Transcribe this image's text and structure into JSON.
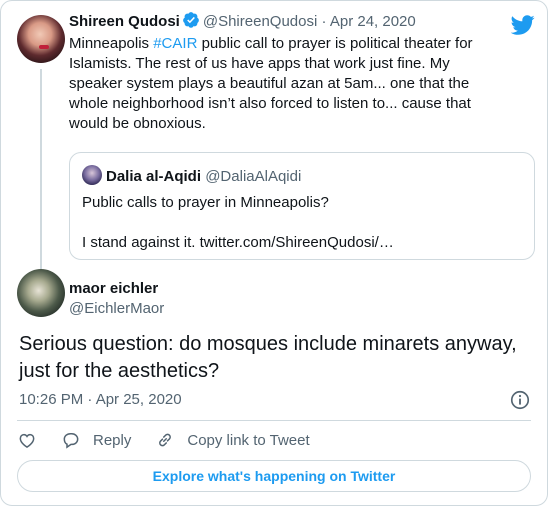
{
  "colors": {
    "accent": "#1d9bf0",
    "text": "#0f1419",
    "muted": "#536471",
    "border": "#cfd9de"
  },
  "icons": {
    "brand": "twitter-bird-icon",
    "verified": "verified-badge-icon",
    "info": "info-icon",
    "like": "heart-icon",
    "reply": "reply-bubble-icon",
    "link": "link-icon"
  },
  "parent_tweet": {
    "name": "Shireen Qudosi",
    "handle": "@ShireenQudosi",
    "separator": "·",
    "date": "Apr 24, 2020",
    "text_before": "Minneapolis ",
    "hashtag": "#CAIR",
    "text_after": " public call to prayer is political theater for Islamists. The rest of us have apps that work just fine. My speaker system plays a beautiful azan at 5am... one that the whole neighborhood isn’t also forced to listen to... cause that would be obnoxious."
  },
  "quoted_tweet": {
    "name": "Dalia al-Aqidi",
    "handle": "@DaliaAlAqidi",
    "line1": "Public calls to prayer in Minneapolis?",
    "line2": "I stand against it. twitter.com/ShireenQudosi/…"
  },
  "main_tweet": {
    "name": "maor eichler",
    "handle": "@EichlerMaor",
    "text": "Serious question: do mosques include minarets anyway, just for the aesthetics?",
    "timestamp": "10:26 PM · Apr 25, 2020"
  },
  "actions": {
    "reply_label": "Reply",
    "copy_link_label": "Copy link to Tweet"
  },
  "explore_label": "Explore what's happening on Twitter"
}
